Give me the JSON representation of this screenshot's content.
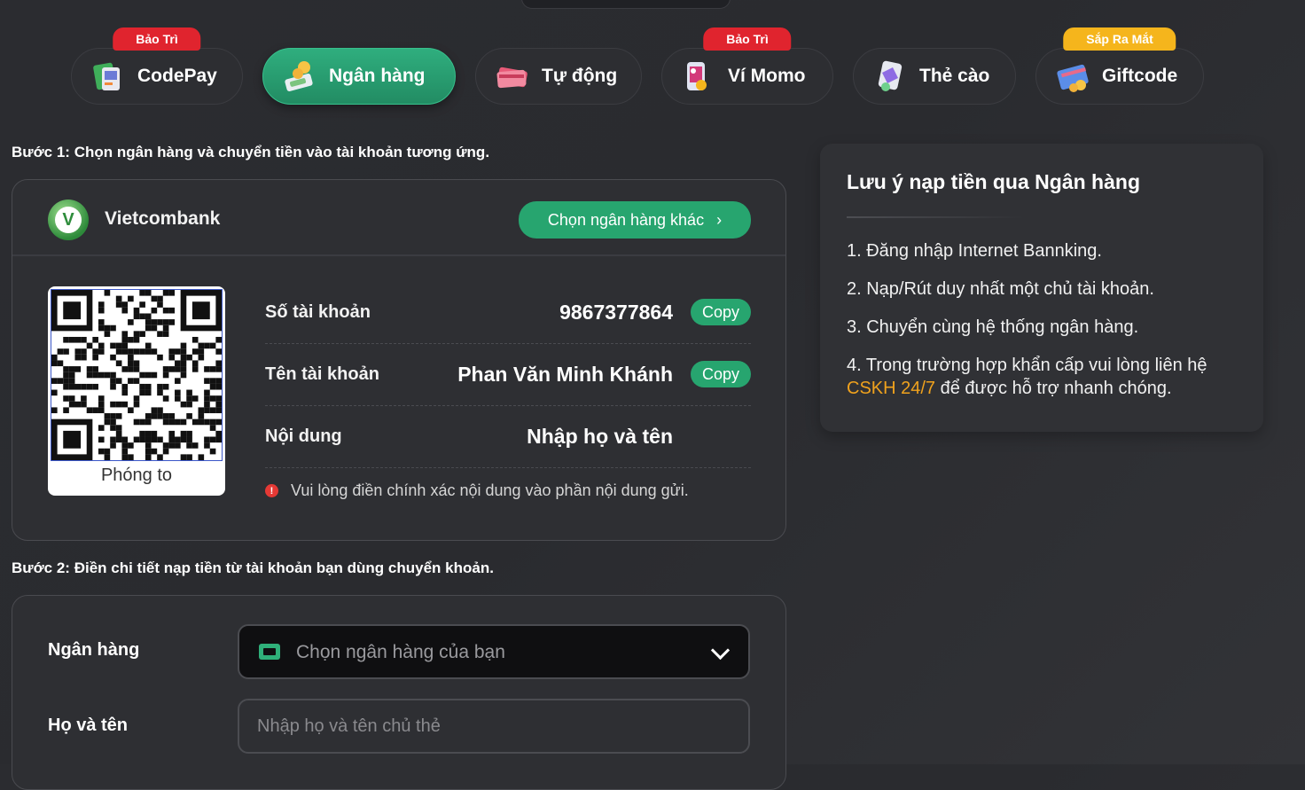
{
  "tabs": [
    {
      "label": "CodePay",
      "badge": "Bảo Trì",
      "icon": "codepay-icon"
    },
    {
      "label": "Ngân hàng",
      "badge": "",
      "icon": "bank-money-icon",
      "active": true
    },
    {
      "label": "Tự động",
      "badge": "",
      "icon": "card-stack-icon"
    },
    {
      "label": "Ví Momo",
      "badge": "Bảo Trì",
      "icon": "momo-wallet-icon"
    },
    {
      "label": "Thẻ cào",
      "badge": "",
      "icon": "scratch-card-icon"
    },
    {
      "label": "Giftcode",
      "badge": "Sắp Ra Mắt",
      "icon": "giftcode-icon"
    }
  ],
  "step1": {
    "title": "Bước 1: Chọn ngân hàng và chuyển tiền vào tài khoản tương ứng.",
    "bank_name": "Vietcombank",
    "choose_other": "Chọn ngân hàng khác",
    "qr_zoom": "Phóng to",
    "rows": [
      {
        "label": "Số tài khoản",
        "value": "9867377864",
        "copy": "Copy"
      },
      {
        "label": "Tên tài khoản",
        "value": "Phan Văn Minh Khánh",
        "copy": "Copy"
      },
      {
        "label": "Nội dung",
        "value": "Nhập họ và tên"
      }
    ],
    "warning": "Vui lòng điền chính xác nội dung vào phần nội dung gửi."
  },
  "step2": {
    "title": "Bước 2: Điền chi tiết nạp tiền từ tài khoản bạn dùng chuyển khoản.",
    "bank_label": "Ngân hàng",
    "bank_select": "Chọn ngân hàng của bạn",
    "name_label": "Họ và tên",
    "name_placeholder": "Nhập họ và tên chủ thẻ"
  },
  "notes": {
    "title": "Lưu ý nạp tiền qua Ngân hàng",
    "items": [
      "1. Đăng nhập Internet Bannking.",
      "2. Nạp/Rút duy nhất một chủ tài khoản.",
      "3. Chuyển cùng hệ thống ngân hàng."
    ],
    "item4_prefix": "4. Trong trường hợp khẩn cấp vui lòng liên hệ ",
    "item4_link": "CSKH 24/7",
    "item4_suffix": " để được hỗ trợ nhanh chóng."
  },
  "colors": {
    "accent": "#27a56f",
    "maintenance": "#e0242e",
    "coming_soon": "#f5b51c",
    "link": "#f0a21d"
  }
}
